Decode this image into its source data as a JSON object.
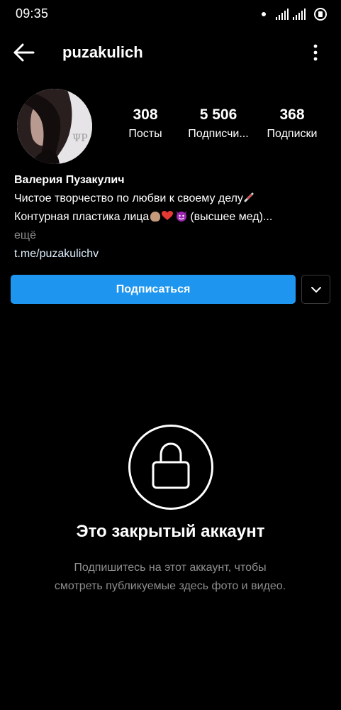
{
  "status_bar": {
    "time": "09:35",
    "icons": [
      "notification-dot-icon",
      "signal-icon",
      "signal-icon",
      "battery-icon"
    ]
  },
  "header": {
    "username": "puzakulich",
    "back_icon": "arrow-left-icon",
    "more_icon": "more-vertical-icon"
  },
  "profile": {
    "stats": [
      {
        "value": "308",
        "label": "Посты"
      },
      {
        "value": "5 506",
        "label": "Подписчи..."
      },
      {
        "value": "368",
        "label": "Подписки"
      }
    ],
    "bio": {
      "name": "Валерия Пузакулич",
      "line1": "Чистое творчество по любви к своему делу",
      "line2_start": "Контурная пластика лица",
      "line2_end": "(высшее мед)...",
      "more": "ещё",
      "link": "t.me/puzakulichv"
    }
  },
  "actions": {
    "follow_label": "Подписаться",
    "dropdown_icon": "chevron-down-icon"
  },
  "private": {
    "icon": "lock-icon",
    "title": "Это закрытый аккаунт",
    "description": "Подпишитесь на этот аккаунт, чтобы смотреть публикуемые здесь фото и видео."
  },
  "colors": {
    "background": "#000000",
    "accent": "#1E96F0",
    "secondary_text": "#8E8E8E"
  }
}
